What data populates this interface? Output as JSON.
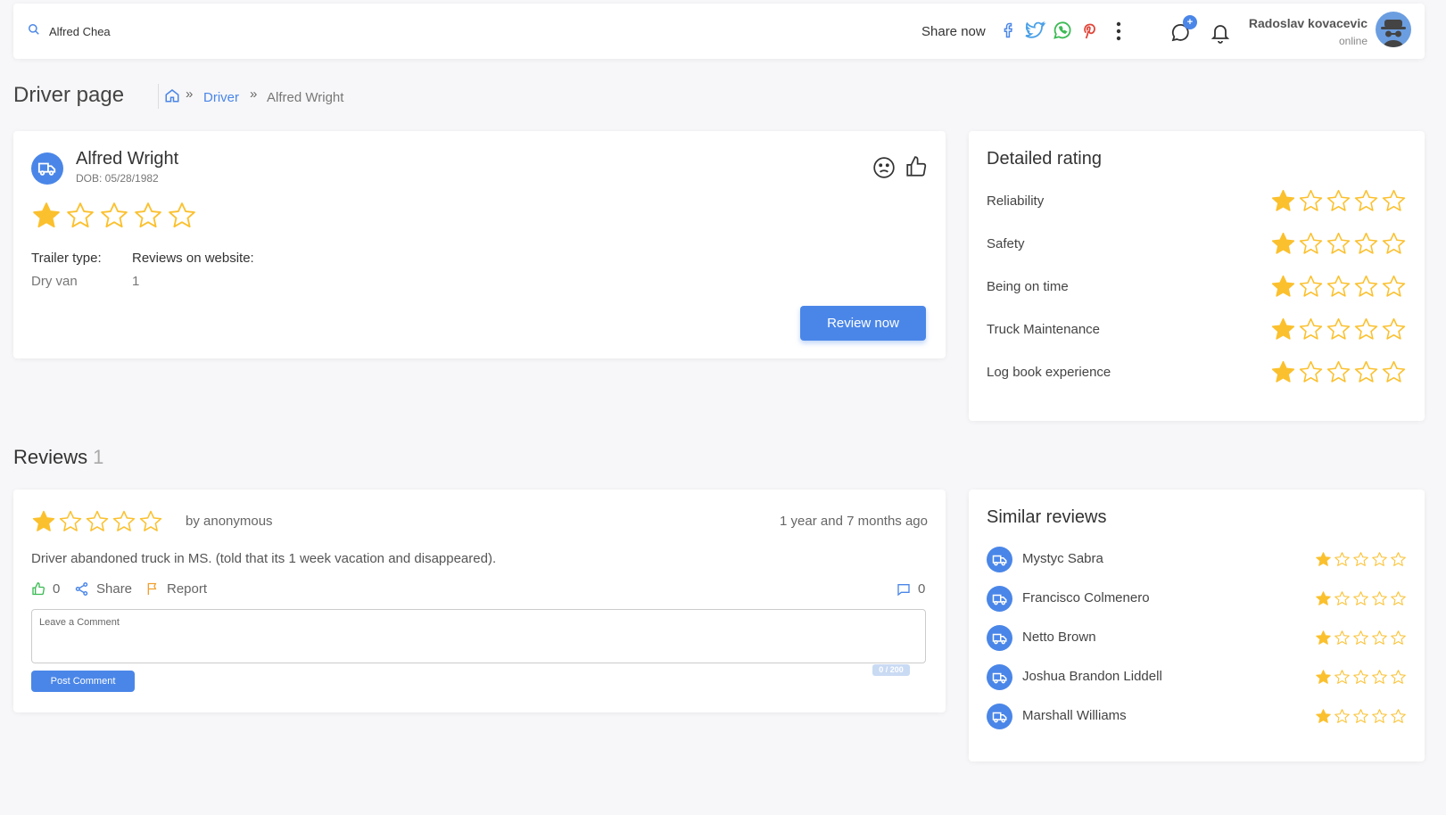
{
  "search": {
    "value": "Alfred Chea"
  },
  "header": {
    "share_label": "Share now",
    "chat_badge": "+",
    "user_name": "Radoslav kovacevic",
    "user_status": "online"
  },
  "page": {
    "title": "Driver page",
    "breadcrumb": {
      "driver": "Driver",
      "current": "Alfred Wright",
      "separator": "»"
    }
  },
  "driver": {
    "name": "Alfred Wright",
    "dob": "DOB: 05/28/1982",
    "rating": 1,
    "max_rating": 5,
    "trailer_label": "Trailer type:",
    "trailer_value": "Dry van",
    "reviews_label": "Reviews on website:",
    "reviews_value": "1",
    "review_button": "Review now"
  },
  "detailed_rating": {
    "title": "Detailed rating",
    "items": [
      {
        "label": "Reliability",
        "rating": 1
      },
      {
        "label": "Safety",
        "rating": 1
      },
      {
        "label": "Being on time",
        "rating": 1
      },
      {
        "label": "Truck Maintenance",
        "rating": 1
      },
      {
        "label": "Log book experience",
        "rating": 1
      }
    ]
  },
  "reviews": {
    "heading": "Reviews",
    "count": "1",
    "items": [
      {
        "rating": 1,
        "author": "by anonymous",
        "time": "1 year and 7 months ago",
        "text": "Driver abandoned truck in MS. (told that its 1 week vacation and disappeared).",
        "likes": "0",
        "share_label": "Share",
        "report_label": "Report",
        "comments": "0",
        "comment_placeholder": "Leave a Comment",
        "char_counter": "0 / 200",
        "post_label": "Post Comment"
      }
    ]
  },
  "similar": {
    "title": "Similar reviews",
    "items": [
      {
        "name": "Mystyc Sabra",
        "rating": 1
      },
      {
        "name": "Francisco Colmenero",
        "rating": 1
      },
      {
        "name": "Netto Brown",
        "rating": 1
      },
      {
        "name": "Joshua Brandon Liddell",
        "rating": 1
      },
      {
        "name": "Marshall Williams",
        "rating": 1
      }
    ]
  },
  "colors": {
    "accent": "#4a86e8",
    "star": "#fbc02d",
    "background": "#f7f7f9"
  }
}
